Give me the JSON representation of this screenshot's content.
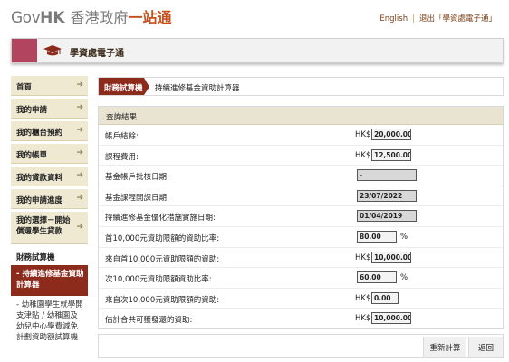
{
  "header": {
    "logo_gov": "Gov",
    "logo_hk": "HK",
    "logo_cn": "香港政府",
    "logo_cn_accent": "一站通",
    "english_link": "English",
    "logout_link": "退出「學資處電子通」"
  },
  "banner": {
    "title": "學資處電子通"
  },
  "sidebar": {
    "items": [
      {
        "label": "首頁"
      },
      {
        "label": "我的申請"
      },
      {
        "label": "我的櫃台預約"
      },
      {
        "label": "我的帳單"
      },
      {
        "label": "我的貸款資料"
      },
      {
        "label": "我的申請進度"
      },
      {
        "label": "我的選擇－開始償還學生貸款"
      }
    ],
    "section_title": "財務試算機",
    "active_item": "- 持續進修基金資助計算器",
    "other_item": "- 幼稚園學生就學開支津貼 / 幼稚園及幼兒中心學費減免計劃資助額試算機"
  },
  "breadcrumb": {
    "category": "財務試算機",
    "page": "持續進修基金資助計算器"
  },
  "results": {
    "heading": "查詢結果",
    "currency": "HK$",
    "rows": [
      {
        "label": "帳戶結餘:",
        "value": "20,000.00",
        "type": "money"
      },
      {
        "label": "課程費用:",
        "value": "12,500.00",
        "type": "money"
      },
      {
        "label": "基金帳戶批核日期:",
        "value": "-",
        "type": "text"
      },
      {
        "label": "基金課程開課日期:",
        "value": "23/07/2022",
        "type": "text"
      },
      {
        "label": "持續進修基金優化措施實施日期:",
        "value": "01/04/2019",
        "type": "text"
      },
      {
        "label": "首10,000元資助限額的資助比率:",
        "value": "80.00",
        "type": "pct"
      },
      {
        "label": "來自首10,000元資助限額的資助:",
        "value": "10,000.00",
        "type": "money"
      },
      {
        "label": "次10,000元資助限額資助比率:",
        "value": "60.00",
        "type": "pct"
      },
      {
        "label": "來自次10,000元資助限額的資助:",
        "value": "0.00",
        "type": "money"
      },
      {
        "label": "估計合共可獲發還的資助:",
        "value": "10,000.00",
        "type": "money"
      }
    ],
    "percent_sign": "%"
  },
  "actions": {
    "recalculate": "重新計算",
    "back": "返回"
  },
  "colors": {
    "accent": "#8c2a1c",
    "banner_accent": "#b24460",
    "nav_bg": "#efe9d2"
  }
}
